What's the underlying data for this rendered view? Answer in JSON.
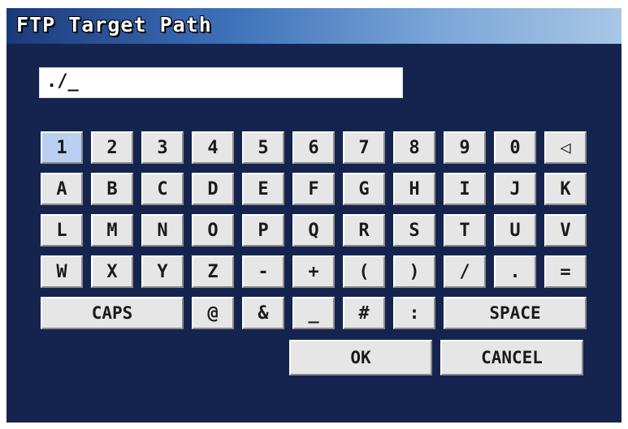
{
  "dialog": {
    "title": "FTP Target Path",
    "input_value": "./_"
  },
  "keyboard": {
    "row1": [
      "1",
      "2",
      "3",
      "4",
      "5",
      "6",
      "7",
      "8",
      "9",
      "0",
      "◁"
    ],
    "row2": [
      "A",
      "B",
      "C",
      "D",
      "E",
      "F",
      "G",
      "H",
      "I",
      "J",
      "K"
    ],
    "row3": [
      "L",
      "M",
      "N",
      "O",
      "P",
      "Q",
      "R",
      "S",
      "T",
      "U",
      "V"
    ],
    "row4": [
      "W",
      "X",
      "Y",
      "Z",
      "-",
      "+",
      "(",
      ")",
      "/",
      ".",
      "="
    ],
    "row5": {
      "caps": "CAPS",
      "keys": [
        "@",
        "&",
        "_",
        "#",
        ":"
      ],
      "space": "SPACE"
    },
    "ok": "OK",
    "cancel": "CANCEL"
  }
}
